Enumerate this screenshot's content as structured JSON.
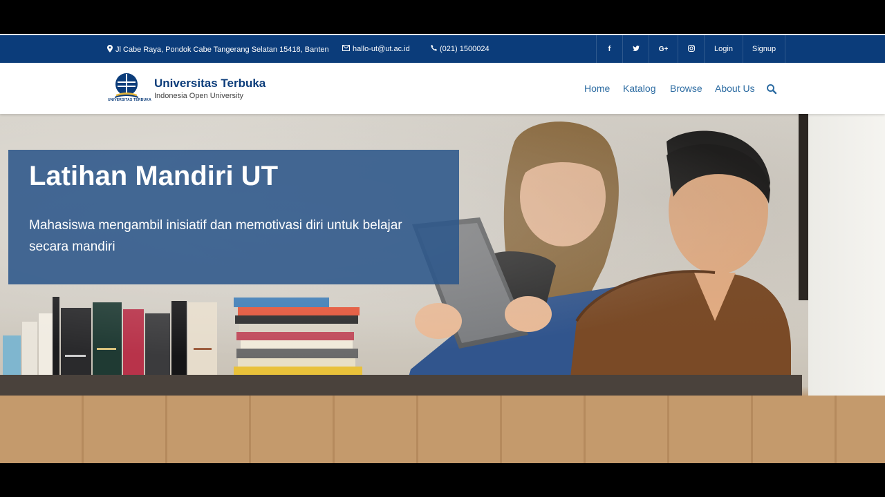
{
  "topbar": {
    "address": "Jl Cabe Raya, Pondok Cabe Tangerang Selatan 15418, Banten",
    "email": "hallo-ut@ut.ac.id",
    "phone": "(021) 1500024",
    "social": {
      "facebook": "f",
      "twitter": "t",
      "google_plus": "G+",
      "instagram": "◎"
    },
    "login_label": "Login",
    "signup_label": "Signup",
    "icons": [
      "map-marker-icon",
      "envelope-icon",
      "phone-icon",
      "facebook-icon",
      "twitter-icon",
      "google-plus-icon",
      "instagram-icon"
    ]
  },
  "header": {
    "brand_name": "Universitas Terbuka",
    "brand_tagline": "Indonesia Open University",
    "logo_caption": "UNIVERSITAS TERBUKA",
    "nav": [
      "Home",
      "Katalog",
      "Browse",
      "About Us"
    ],
    "icons": [
      "search-icon"
    ]
  },
  "hero": {
    "title": "Latihan Mandiri UT",
    "subtitle": "Mahasiswa mengambil inisiatif dan memotivasi diri untuk belajar secara mandiri"
  },
  "colors": {
    "topbar_bg": "#0b3c7a",
    "nav_link": "#2d6ca2",
    "brand": "#0b3c7a",
    "overlay": "#2c568a"
  }
}
